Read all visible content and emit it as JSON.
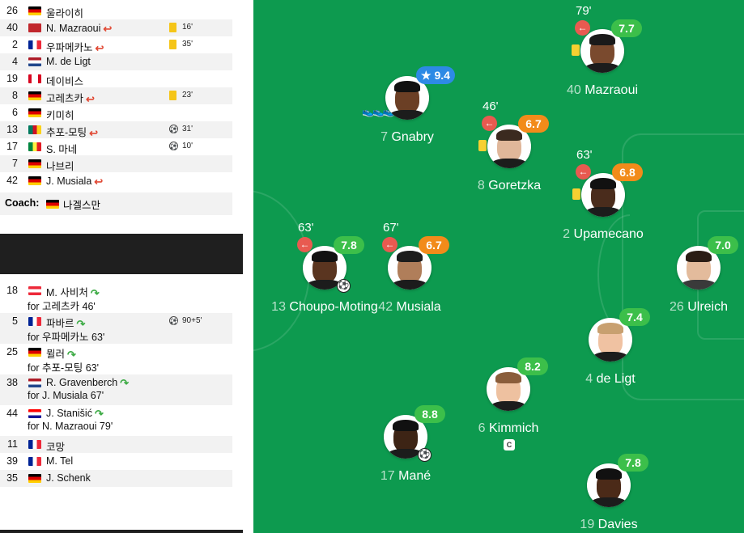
{
  "colors": {
    "pitch": "#0d9a4f",
    "rating_green": "#3cbf4a",
    "rating_orange": "#f28b1a",
    "rating_blue": "#2d8ae5",
    "sub_out": "#e85a50",
    "sub_in": "#3eab46",
    "yellow_card": "#f5c518"
  },
  "lineup": [
    {
      "num": "26",
      "name": "울라이히",
      "flag": "germany",
      "sub": false,
      "event": "",
      "time": ""
    },
    {
      "num": "40",
      "name": "N. Mazraoui",
      "flag": "morocco",
      "sub": true,
      "event": "yellow-card",
      "time": "16'"
    },
    {
      "num": "2",
      "name": "우파메카노",
      "flag": "france",
      "sub": true,
      "event": "yellow-card",
      "time": "35'"
    },
    {
      "num": "4",
      "name": "M. de Ligt",
      "flag": "netherlands",
      "sub": false,
      "event": "",
      "time": ""
    },
    {
      "num": "19",
      "name": "데이비스",
      "flag": "canada",
      "sub": false,
      "event": "",
      "time": ""
    },
    {
      "num": "8",
      "name": "고레츠카",
      "flag": "germany",
      "sub": true,
      "event": "yellow-card",
      "time": "23'"
    },
    {
      "num": "6",
      "name": "키미히",
      "flag": "germany",
      "sub": false,
      "event": "",
      "time": ""
    },
    {
      "num": "13",
      "name": "추포-모팅",
      "flag": "cameroon",
      "sub": true,
      "event": "goal",
      "time": "31'"
    },
    {
      "num": "17",
      "name": "S. 마네",
      "flag": "senegal",
      "sub": false,
      "event": "goal",
      "time": "10'"
    },
    {
      "num": "7",
      "name": "나브리",
      "flag": "germany",
      "sub": false,
      "event": "",
      "time": ""
    },
    {
      "num": "42",
      "name": "J. Musiala",
      "flag": "germany",
      "sub": true,
      "event": "",
      "time": ""
    }
  ],
  "coach": {
    "label": "Coach:",
    "name": "나겔스만",
    "flag": "germany"
  },
  "subs": [
    {
      "num": "18",
      "name": "M. 사비처",
      "flag": "austria",
      "for": "for 고레츠카 46'",
      "event": "",
      "time": ""
    },
    {
      "num": "5",
      "name": "파바르",
      "flag": "france",
      "for": "for 우파메카노 63'",
      "event": "goal",
      "time": "90+5'"
    },
    {
      "num": "25",
      "name": "뮐러",
      "flag": "germany",
      "for": "for 추포-모팅 63'",
      "event": "",
      "time": ""
    },
    {
      "num": "38",
      "name": "R. Gravenberch",
      "flag": "netherlands",
      "for": "for J. Musiala 67'",
      "event": "",
      "time": ""
    },
    {
      "num": "44",
      "name": "J. Stanišić",
      "flag": "croatia",
      "for": "for N. Mazraoui 79'",
      "event": "",
      "time": ""
    }
  ],
  "bench": [
    {
      "num": "11",
      "name": "코망",
      "flag": "france"
    },
    {
      "num": "39",
      "name": "M. Tel",
      "flag": "france"
    },
    {
      "num": "35",
      "name": "J. Schenk",
      "flag": "germany"
    }
  ],
  "pitch_players": [
    {
      "id": "mazraoui",
      "num": "40",
      "name": "Mazraoui",
      "rating": "7.7",
      "rcolor": "green",
      "mins": "79'",
      "subout": true,
      "ycard": true
    },
    {
      "id": "gnabry",
      "num": "7",
      "name": "Gnabry",
      "rating": "★ 9.4",
      "rcolor": "blue",
      "boots": "👟👟👟"
    },
    {
      "id": "goretzka",
      "num": "8",
      "name": "Goretzka",
      "rating": "6.7",
      "rcolor": "orange",
      "mins": "46'",
      "subout": true,
      "ycard": true
    },
    {
      "id": "upamecano",
      "num": "2",
      "name": "Upamecano",
      "rating": "6.8",
      "rcolor": "orange",
      "mins": "63'",
      "subout": true,
      "ycard": true
    },
    {
      "id": "choupo",
      "num": "13",
      "name": "Choupo-Moting",
      "rating": "7.8",
      "rcolor": "green",
      "mins": "63'",
      "subout": true,
      "goal": true
    },
    {
      "id": "musiala",
      "num": "42",
      "name": "Musiala",
      "rating": "6.7",
      "rcolor": "orange",
      "mins": "67'",
      "subout": true
    },
    {
      "id": "ulreich",
      "num": "26",
      "name": "Ulreich",
      "rating": "7.0",
      "rcolor": "green"
    },
    {
      "id": "deligt",
      "num": "4",
      "name": "de Ligt",
      "rating": "7.4",
      "rcolor": "green"
    },
    {
      "id": "kimmich",
      "num": "6",
      "name": "Kimmich",
      "rating": "8.2",
      "rcolor": "green",
      "captain": "C"
    },
    {
      "id": "mane",
      "num": "17",
      "name": "Mané",
      "rating": "8.8",
      "rcolor": "green",
      "goal": true
    },
    {
      "id": "davies",
      "num": "19",
      "name": "Davies",
      "rating": "7.8",
      "rcolor": "green"
    }
  ],
  "icons": {
    "sub_out_arrow": "←",
    "sub_in_arrow": "↷",
    "sub_off_arrow": "↩",
    "goal_ball": "⚽",
    "captain": "C"
  }
}
